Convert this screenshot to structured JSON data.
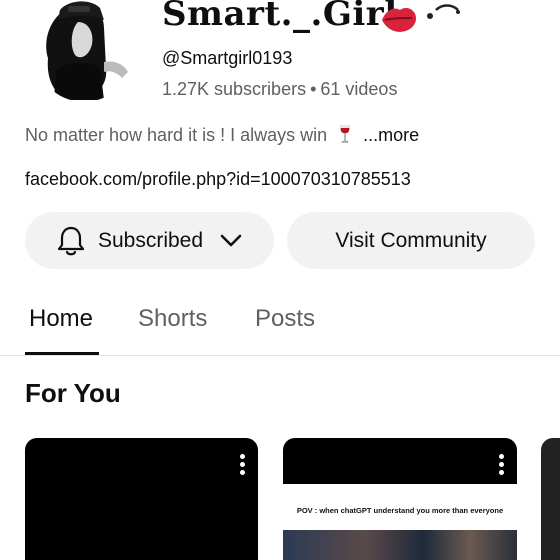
{
  "channel": {
    "name": "Smart._.Girl",
    "handle": "@Smartgirl0193",
    "subscribers": "1.27K subscribers",
    "separator": "•",
    "videos": "61 videos",
    "description": "No matter how hard it is ! I always win",
    "more_label": "...more",
    "link": "facebook.com/profile.php?id=100070310785513"
  },
  "buttons": {
    "subscribed_label": "Subscribed",
    "community_label": "Visit Community"
  },
  "tabs": [
    {
      "label": "Home",
      "active": true
    },
    {
      "label": "Shorts",
      "active": false
    },
    {
      "label": "Posts",
      "active": false
    }
  ],
  "section": {
    "title": "For You"
  },
  "cards": [
    {
      "caption": ""
    },
    {
      "caption": "POV : when chatGPT understand you more than everyone"
    }
  ],
  "colors": {
    "background": "#ffffff",
    "button_bg": "#f2f2f2",
    "text_primary": "#0f0f0f",
    "text_secondary": "#606060",
    "lips_red": "#d8233a"
  },
  "icons": [
    "bell-icon",
    "chevron-down-icon",
    "more-vert-icon",
    "wine-glass-icon",
    "lips-icon"
  ]
}
